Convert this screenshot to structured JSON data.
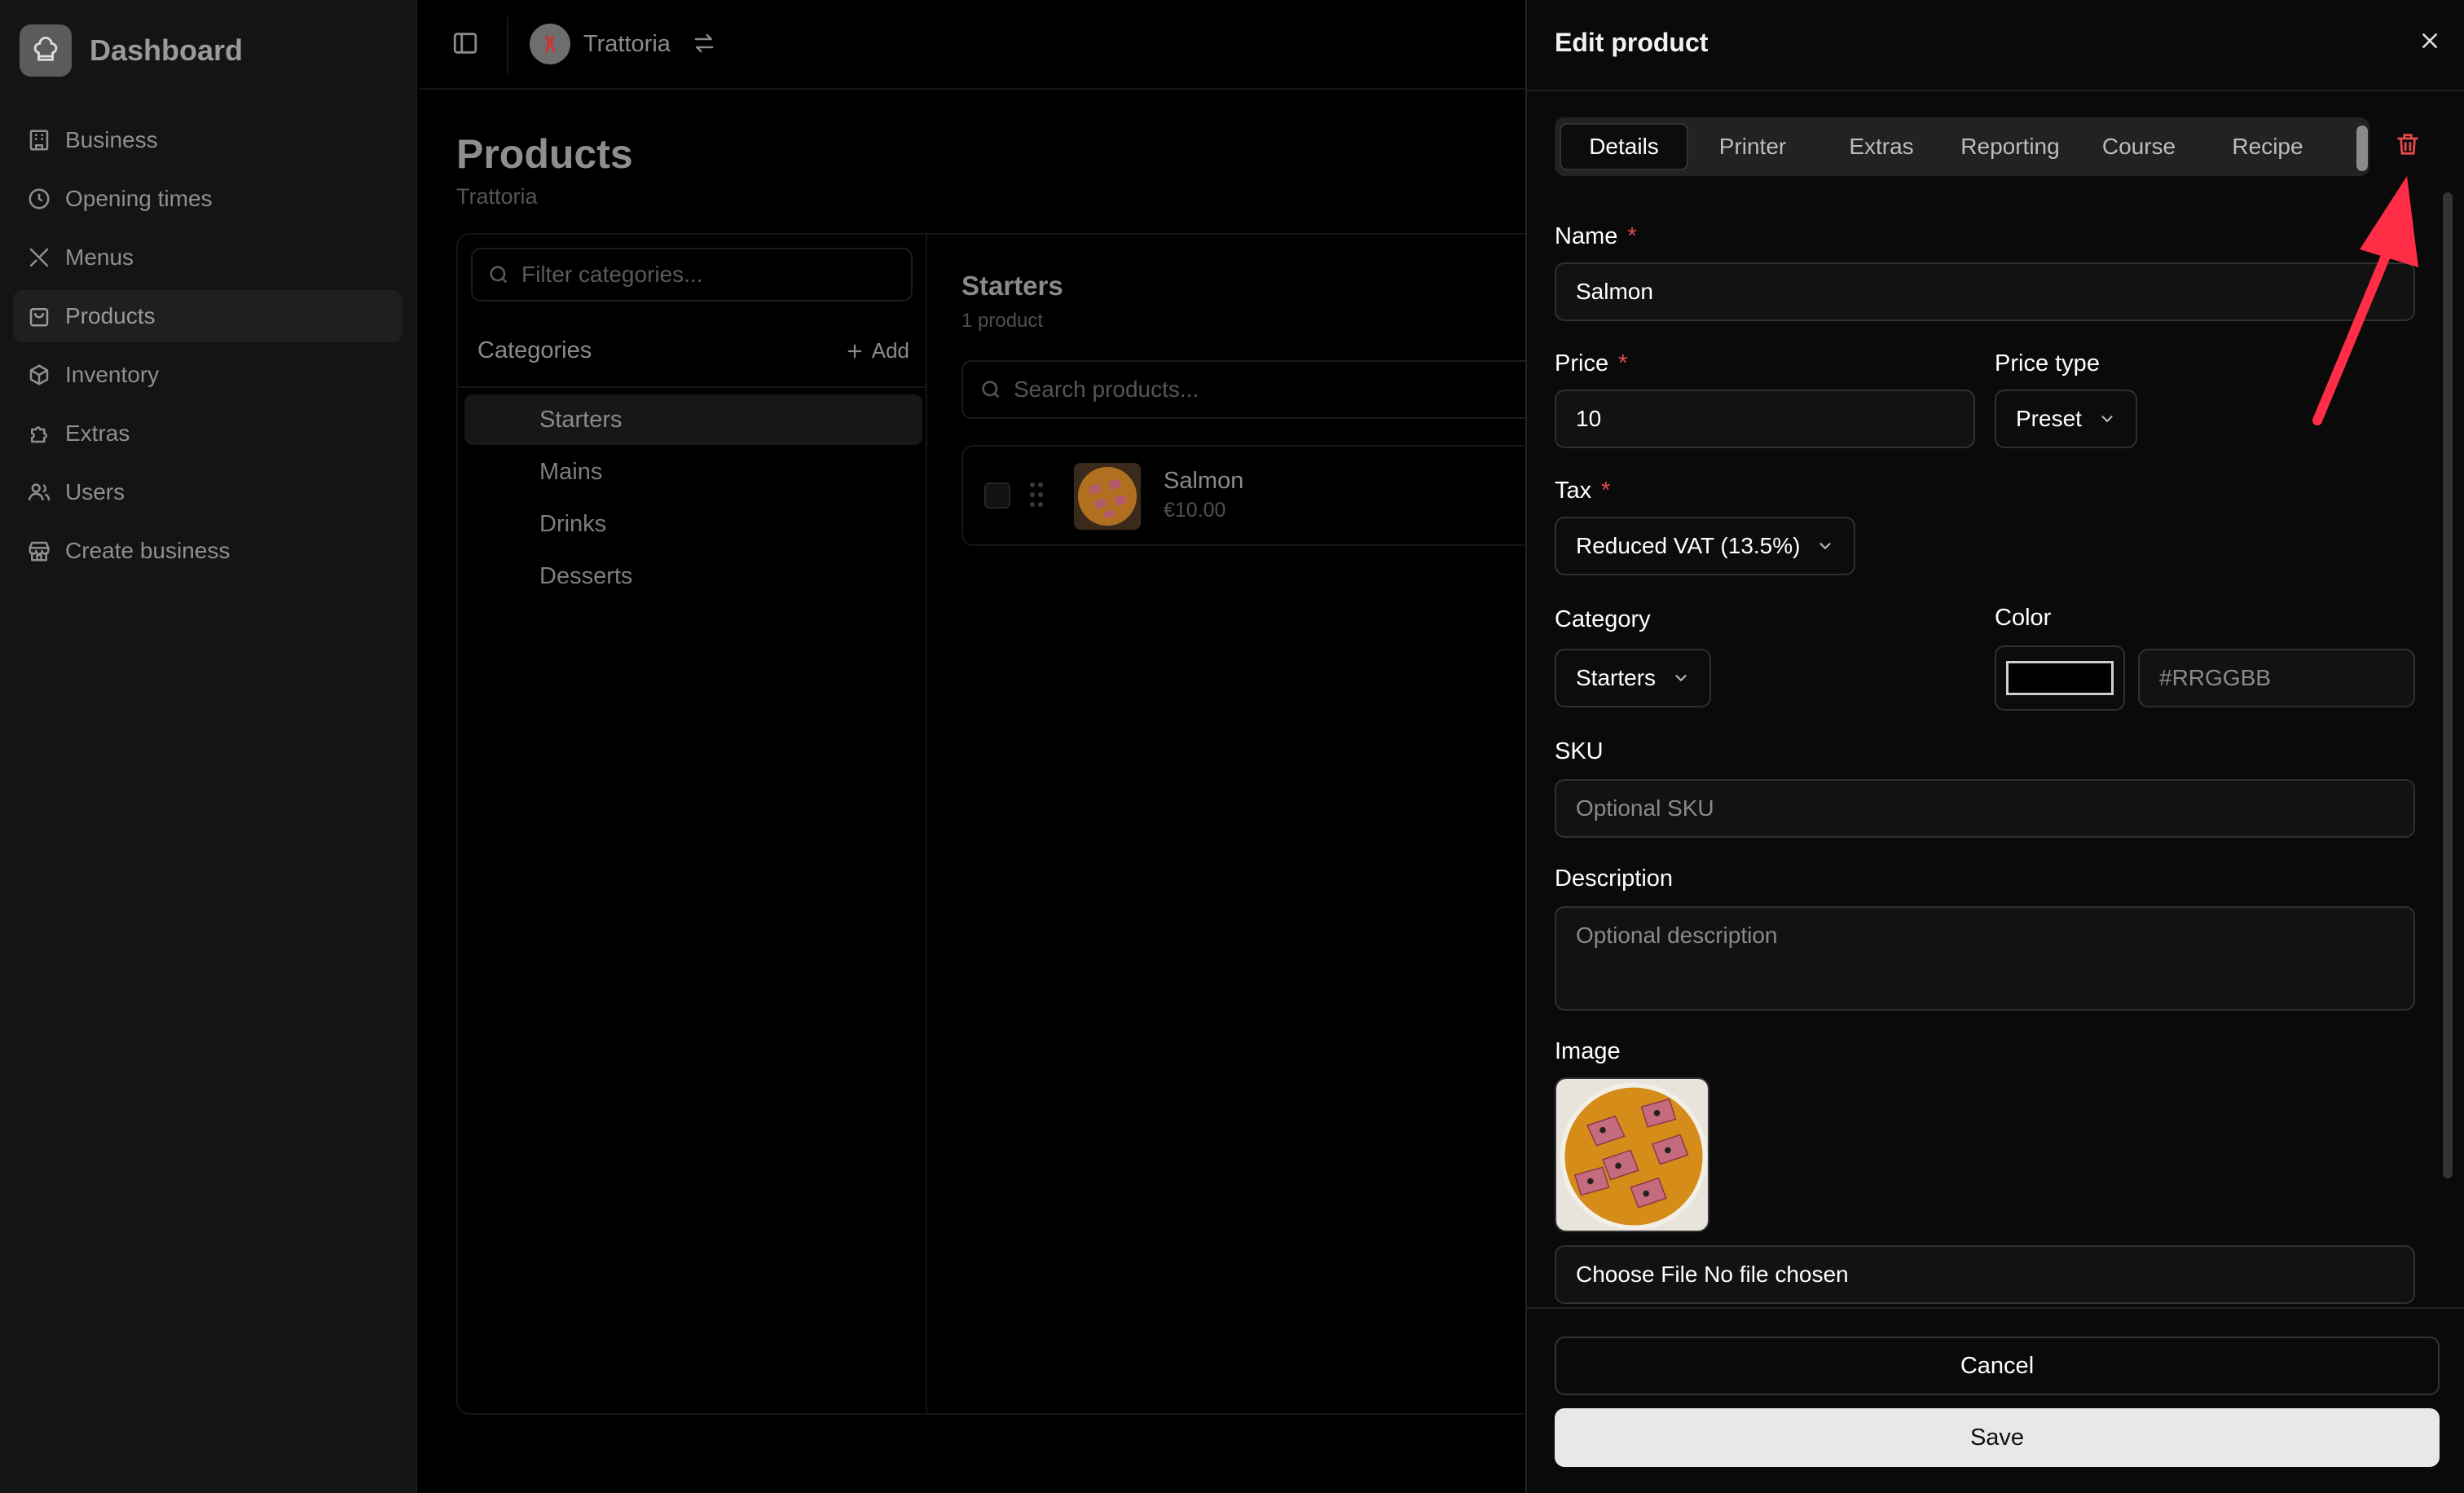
{
  "sidebar": {
    "brand": "Dashboard",
    "items": [
      {
        "label": "Business",
        "icon": "building-icon"
      },
      {
        "label": "Opening times",
        "icon": "clock-icon"
      },
      {
        "label": "Menus",
        "icon": "utensils-icon"
      },
      {
        "label": "Products",
        "icon": "shopping-bag-icon",
        "active": true
      },
      {
        "label": "Inventory",
        "icon": "package-icon"
      },
      {
        "label": "Extras",
        "icon": "puzzle-icon"
      },
      {
        "label": "Users",
        "icon": "users-icon"
      },
      {
        "label": "Create business",
        "icon": "store-icon"
      }
    ]
  },
  "topbar": {
    "tenant": "Trattoria"
  },
  "page": {
    "title": "Products",
    "subtitle": "Trattoria"
  },
  "categories": {
    "filter_placeholder": "Filter categories...",
    "header": "Categories",
    "add_label": "Add",
    "items": [
      "Starters",
      "Mains",
      "Drinks",
      "Desserts"
    ],
    "active": "Starters"
  },
  "products": {
    "heading": "Starters",
    "count": "1 product",
    "search_placeholder": "Search products...",
    "rows": [
      {
        "name": "Salmon",
        "price": "€10.00"
      }
    ]
  },
  "drawer": {
    "title": "Edit product",
    "tabs": [
      "Details",
      "Printer",
      "Extras",
      "Reporting",
      "Course",
      "Recipe"
    ],
    "active_tab": "Details",
    "fields": {
      "name_label": "Name",
      "name_value": "Salmon",
      "price_label": "Price",
      "price_value": "10",
      "price_type_label": "Price type",
      "price_type_value": "Preset",
      "tax_label": "Tax",
      "tax_value": "Reduced VAT (13.5%)",
      "category_label": "Category",
      "category_value": "Starters",
      "color_label": "Color",
      "color_value": "#000000",
      "color_placeholder": "#RRGGBB",
      "sku_label": "SKU",
      "sku_placeholder": "Optional SKU",
      "description_label": "Description",
      "description_placeholder": "Optional description",
      "image_label": "Image",
      "file_text": "Choose File No file chosen",
      "required_mark": "*"
    },
    "cancel_label": "Cancel",
    "save_label": "Save"
  },
  "colors": {
    "background": "#000000",
    "sidebar": "#141414",
    "drawer": "#0a0a0a",
    "danger": "#e5484d",
    "annotation_arrow": "#ff2d46"
  }
}
